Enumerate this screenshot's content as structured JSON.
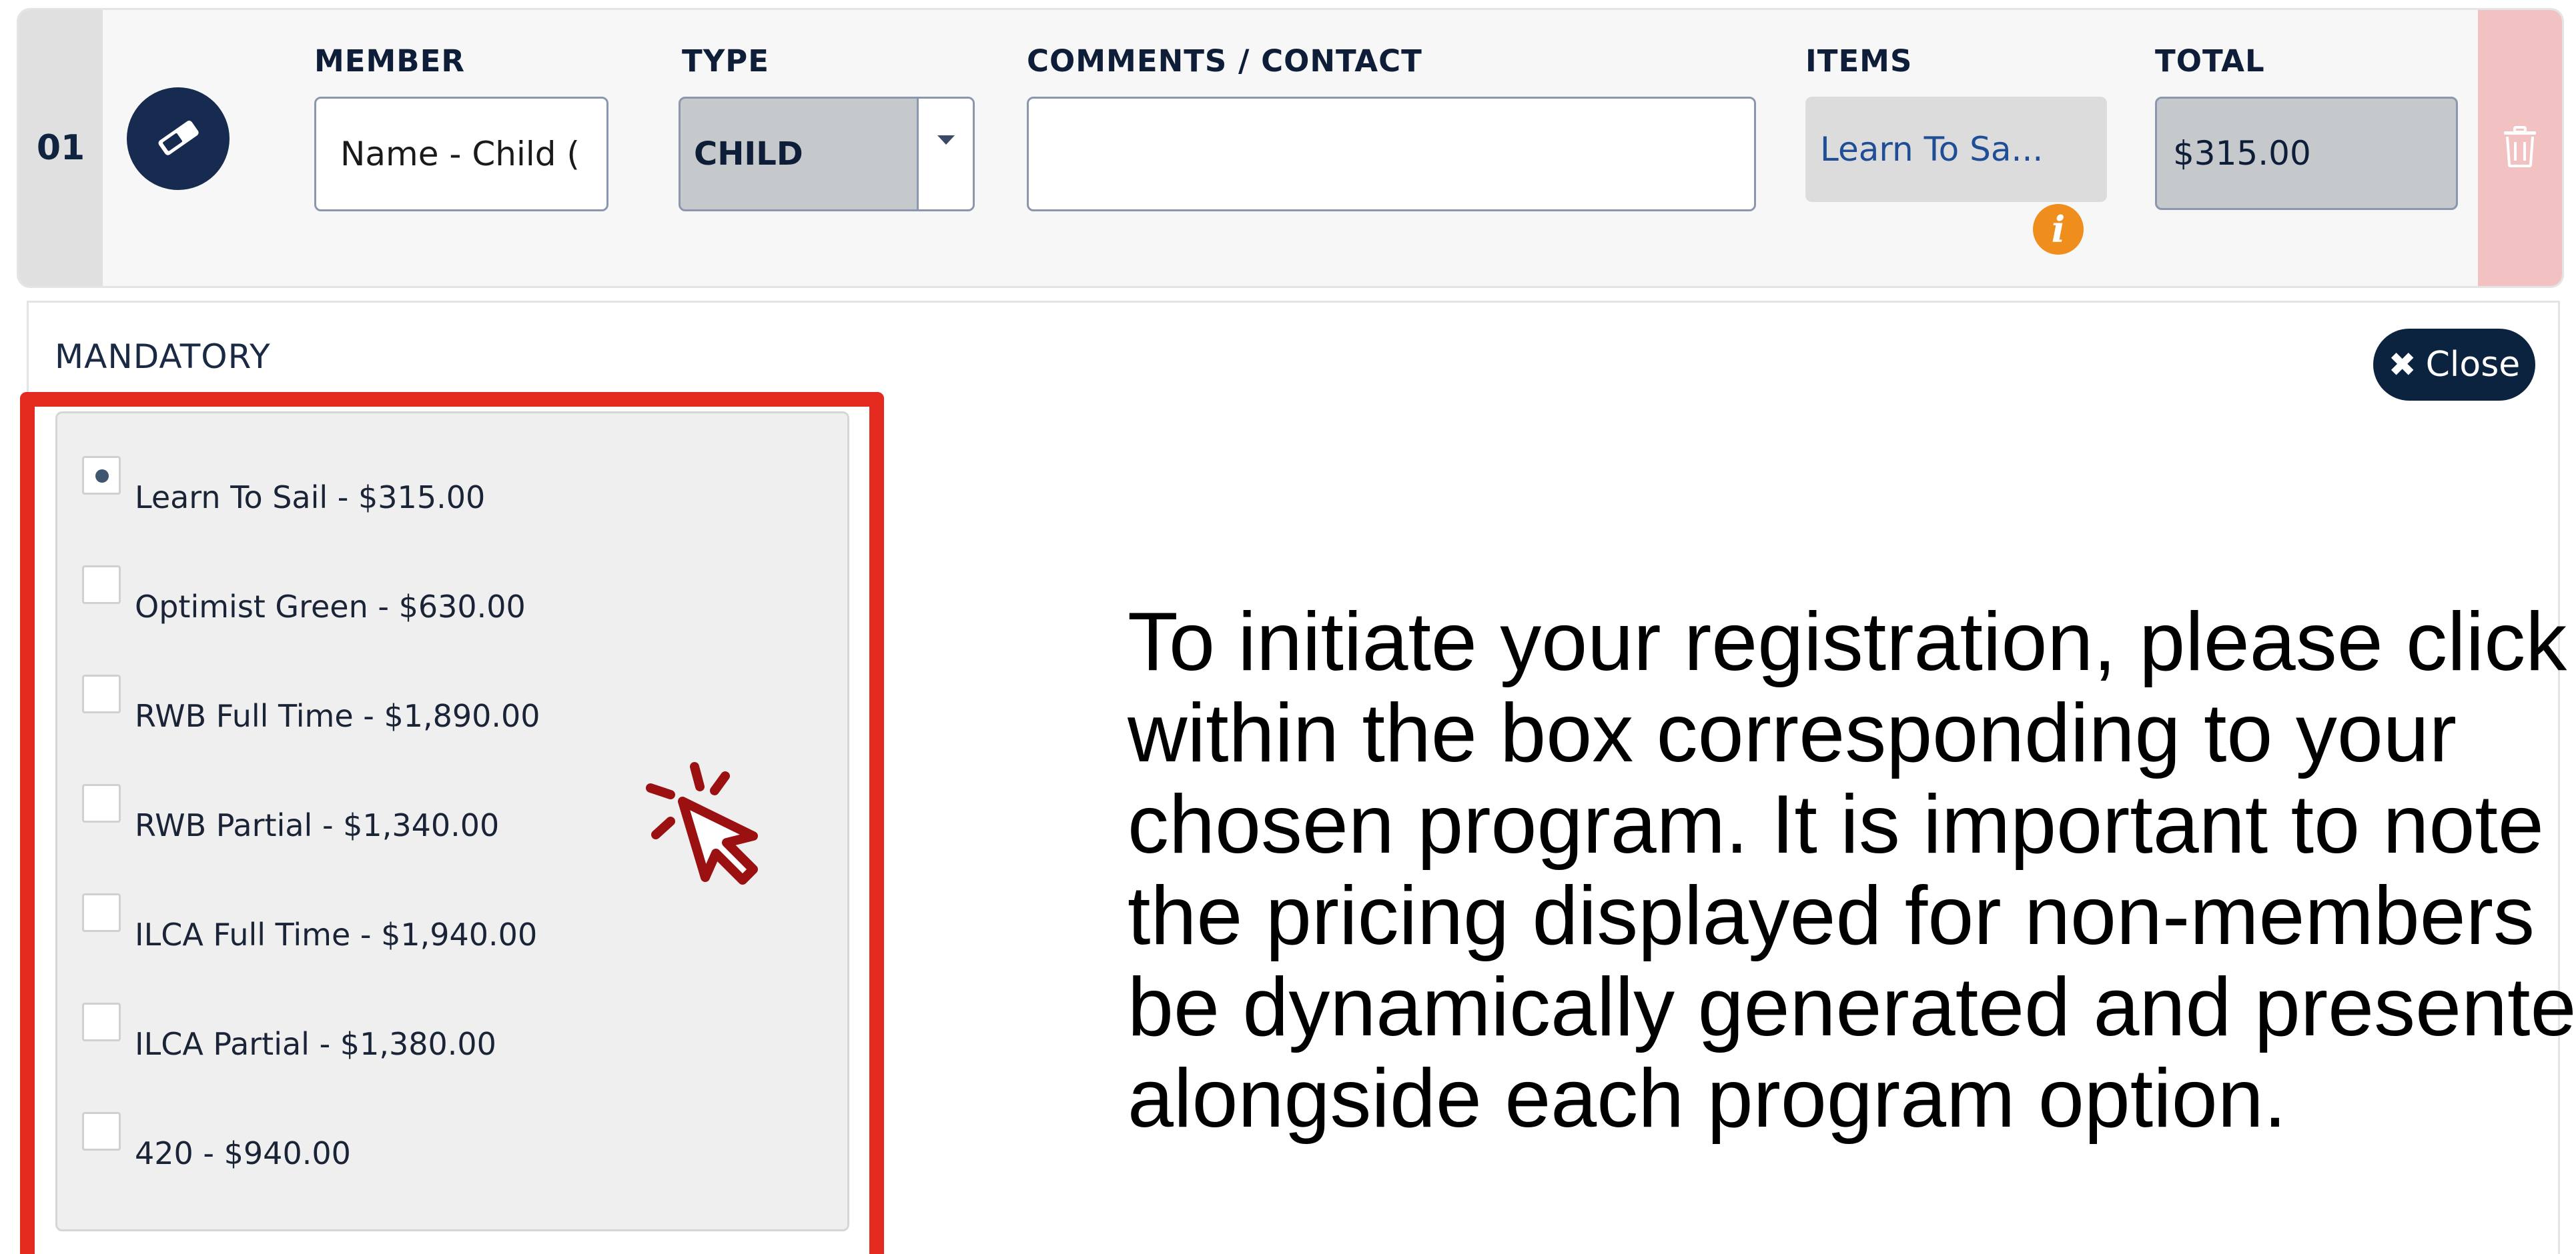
{
  "row": {
    "number": "01",
    "member_label": "MEMBER",
    "member_value": "Name - Child (",
    "type_label": "TYPE",
    "type_value": "CHILD",
    "comments_label": "COMMENTS / CONTACT",
    "comments_value": "",
    "items_label": "ITEMS",
    "items_value": "Learn To Sa...",
    "total_label": "TOTAL",
    "total_value": "$315.00",
    "info_icon_glyph": "i"
  },
  "panel": {
    "section_label": "MANDATORY",
    "close_icon_glyph": "✖",
    "close_label": "Close",
    "options": [
      {
        "label": "Learn To Sail - $315.00",
        "selected": true
      },
      {
        "label": "Optimist Green - $630.00",
        "selected": false
      },
      {
        "label": "RWB Full Time - $1,890.00",
        "selected": false
      },
      {
        "label": "RWB Partial - $1,340.00",
        "selected": false
      },
      {
        "label": "ILCA Full Time - $1,940.00",
        "selected": false
      },
      {
        "label": "ILCA Partial - $1,380.00",
        "selected": false
      },
      {
        "label": "420 - $940.00",
        "selected": false
      }
    ]
  },
  "instruction": {
    "lines": [
      "To initiate your registration, please click",
      "within the box corresponding to your",
      "chosen program. It is important to note",
      "the pricing displayed for non-members",
      "be dynamically generated and presented",
      "alongside each program option."
    ]
  },
  "colors": {
    "navy": "#172a4f",
    "highlight_red": "#e42a1e",
    "cursor_red": "#9b1010",
    "info_orange": "#ef8e1c",
    "delete_pink": "#f2c2c2",
    "items_link_blue": "#1f4e96"
  },
  "icons": {
    "row_action": "eraser-icon",
    "delete": "trash-icon",
    "info": "info-icon",
    "dropdown": "caret-down-icon",
    "pointer": "click-cursor-icon"
  }
}
